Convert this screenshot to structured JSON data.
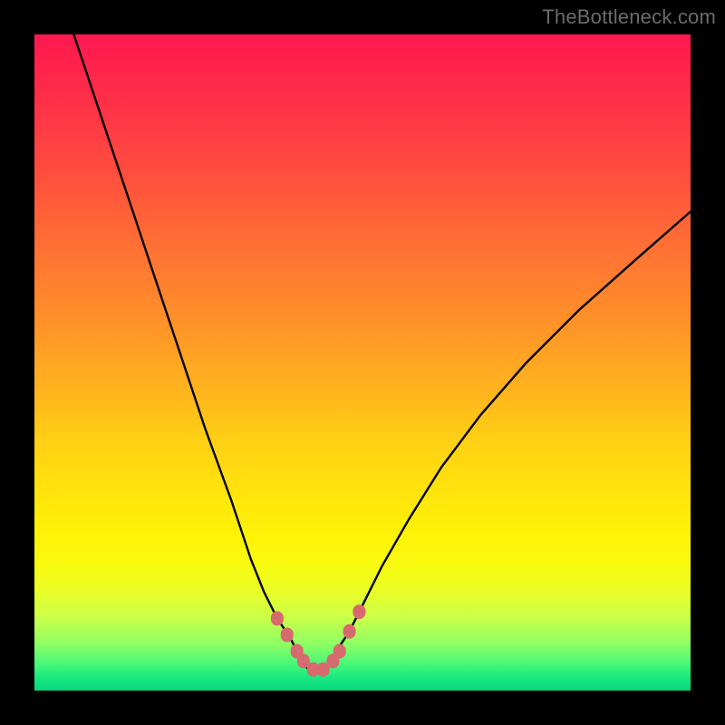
{
  "watermark": "TheBottleneck.com",
  "colors": {
    "frame": "#000000",
    "curve": "#000000",
    "marker": "#d76a6e"
  },
  "chart_data": {
    "type": "line",
    "title": "",
    "xlabel": "",
    "ylabel": "",
    "xlim": [
      0,
      100
    ],
    "ylim": [
      0,
      100
    ],
    "grid": false,
    "series": [
      {
        "name": "bottleneck-curve",
        "x": [
          6,
          10,
          14,
          18,
          22,
          26,
          30,
          33,
          35,
          37,
          39,
          40,
          41,
          42,
          43,
          44,
          45,
          46,
          48,
          50,
          53,
          57,
          62,
          68,
          75,
          83,
          92,
          100
        ],
        "y": [
          100,
          88,
          76,
          64,
          52,
          40,
          29,
          20,
          15,
          11,
          8,
          6,
          4,
          3,
          3,
          3,
          4,
          6,
          9,
          13,
          19,
          26,
          34,
          42,
          50,
          58,
          66,
          73
        ]
      }
    ],
    "markers": {
      "name": "highlight-points",
      "x": [
        37,
        38.5,
        40,
        41,
        42.5,
        44,
        45.5,
        46.5,
        48,
        49.5
      ],
      "y": [
        11,
        8.5,
        6,
        4.5,
        3.2,
        3.2,
        4.5,
        6,
        9,
        12
      ]
    }
  }
}
